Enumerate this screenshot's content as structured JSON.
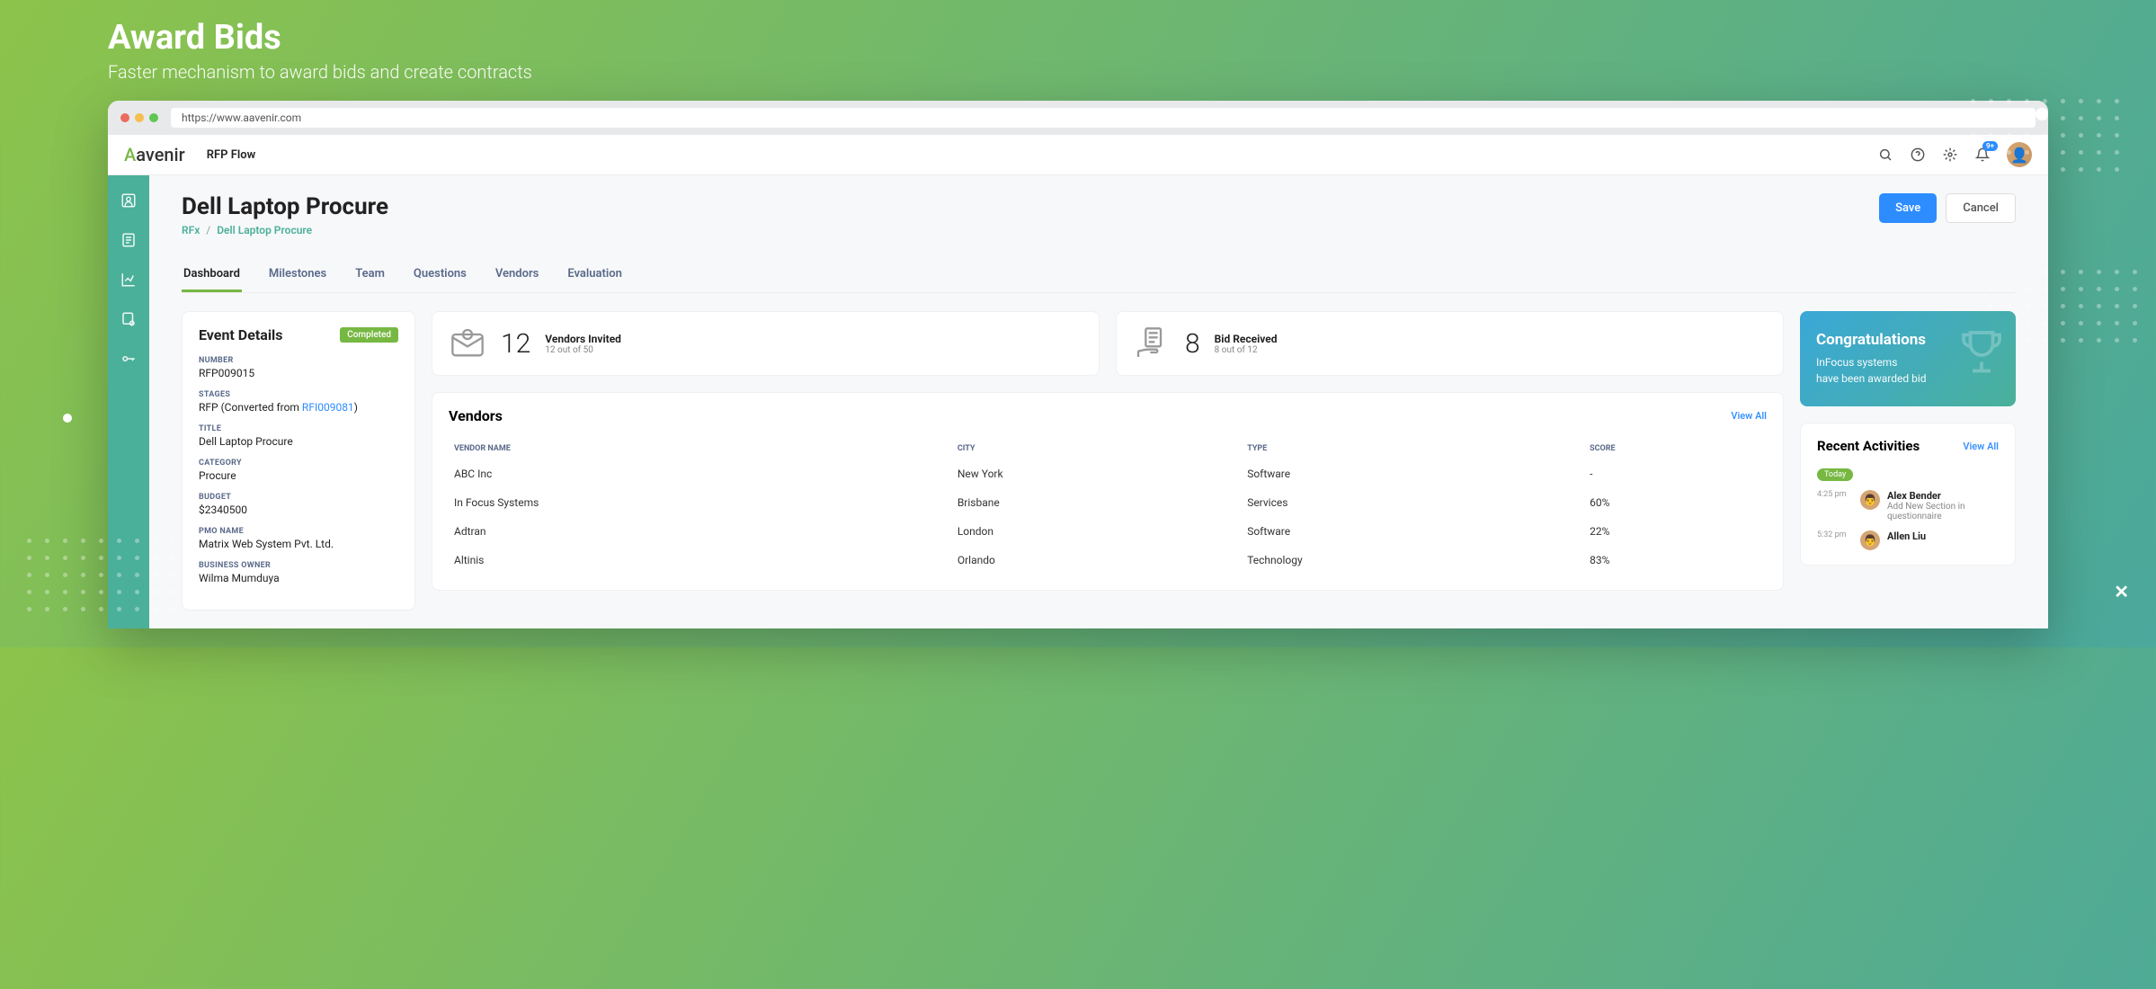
{
  "hero": {
    "title": "Award Bids",
    "subtitle": "Faster mechanism to award bids and create contracts"
  },
  "browser": {
    "url": "https://www.aavenir.com"
  },
  "app": {
    "logo_text": "Aavenir",
    "name": "RFP Flow",
    "notification_badge": "9+"
  },
  "page": {
    "title": "Dell Laptop Procure",
    "breadcrumb": {
      "root": "RFx",
      "leaf": "Dell Laptop Procure"
    },
    "save_label": "Save",
    "cancel_label": "Cancel"
  },
  "tabs": [
    "Dashboard",
    "Milestones",
    "Team",
    "Questions",
    "Vendors",
    "Evaluation"
  ],
  "event": {
    "title": "Event Details",
    "status": "Completed",
    "fields": {
      "number_label": "NUMBER",
      "number_value": "RFP009015",
      "stages_label": "STAGES",
      "stages_prefix": "RFP (Converted from ",
      "stages_link": "RFI009081",
      "stages_suffix": ")",
      "title_label": "TITLE",
      "title_value": "Dell Laptop Procure",
      "category_label": "CATEGORY",
      "category_value": "Procure",
      "budget_label": "BUDGET",
      "budget_value": "$2340500",
      "pmo_label": "PMO NAME",
      "pmo_value": "Matrix Web System Pvt. Ltd.",
      "owner_label": "BUSINESS OWNER",
      "owner_value": "Wilma Mumduya"
    }
  },
  "stats": {
    "invited": {
      "number": "12",
      "title": "Vendors Invited",
      "sub": "12 out of 50"
    },
    "received": {
      "number": "8",
      "title": "Bid Received",
      "sub": "8 out of 12"
    }
  },
  "vendors": {
    "title": "Vendors",
    "view_all": "View All",
    "headers": {
      "name": "VENDOR NAME",
      "city": "CITY",
      "type": "TYPE",
      "score": "SCORE"
    },
    "rows": [
      {
        "name": "ABC Inc",
        "city": "New York",
        "type": "Software",
        "score": "-"
      },
      {
        "name": "In Focus Systems",
        "city": "Brisbane",
        "type": "Services",
        "score": "60%"
      },
      {
        "name": "Adtran",
        "city": "London",
        "type": "Software",
        "score": "22%"
      },
      {
        "name": "Altinis",
        "city": "Orlando",
        "type": "Technology",
        "score": "83%"
      }
    ]
  },
  "congrats": {
    "title": "Congratulations",
    "line1": "InFocus systems",
    "line2": "have been awarded bid"
  },
  "recent": {
    "title": "Recent Activities",
    "view_all": "View All",
    "today_label": "Today",
    "items": [
      {
        "time": "4:25 pm",
        "name": "Alex Bender",
        "desc": "Add New Section in questionnaire"
      },
      {
        "time": "5:32 pm",
        "name": "Allen Liu",
        "desc": ""
      }
    ]
  }
}
